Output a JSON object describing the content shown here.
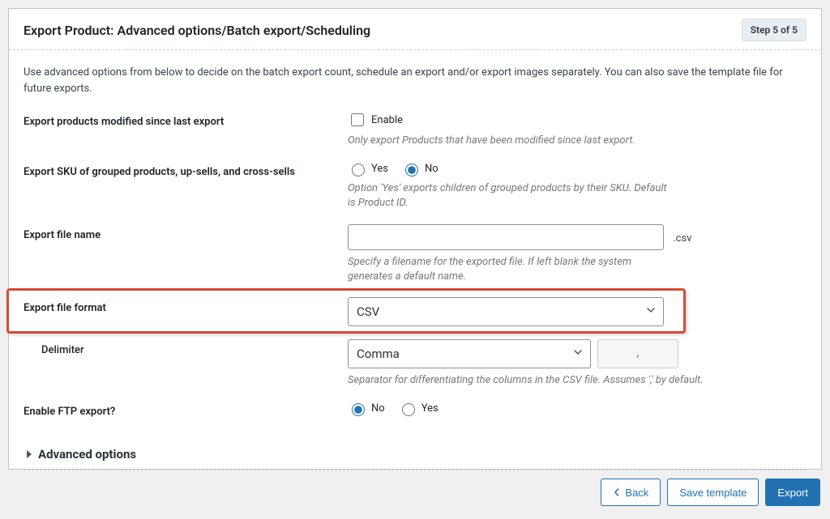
{
  "header": {
    "title": "Export Product: Advanced options/Batch export/Scheduling",
    "step_badge": "Step 5 of 5"
  },
  "intro": "Use advanced options from below to decide on the batch export count, schedule an export and/or export images separately. You can also save the template file for future exports.",
  "rows": {
    "modified": {
      "label": "Export products modified since last export",
      "enable_label": "Enable",
      "help": "Only export Products that have been modified since last export."
    },
    "sku": {
      "label": "Export SKU of grouped products, up-sells, and cross-sells",
      "yes": "Yes",
      "no": "No",
      "help": "Option 'Yes' exports children of grouped products by their SKU. Default is Product ID."
    },
    "filename": {
      "label": "Export file name",
      "ext": ".csv",
      "help": "Specify a filename for the exported file. If left blank the system generates a default name."
    },
    "format": {
      "label": "Export file format",
      "value": "CSV"
    },
    "delimiter": {
      "label": "Delimiter",
      "value": "Comma",
      "char": ",",
      "help": "Separator for differentiating the columns in the CSV file. Assumes ',' by default."
    },
    "ftp": {
      "label": "Enable FTP export?",
      "yes": "Yes",
      "no": "No"
    }
  },
  "advanced_toggle": "Advanced options",
  "footer": {
    "back": "Back",
    "save": "Save template",
    "export": "Export"
  }
}
